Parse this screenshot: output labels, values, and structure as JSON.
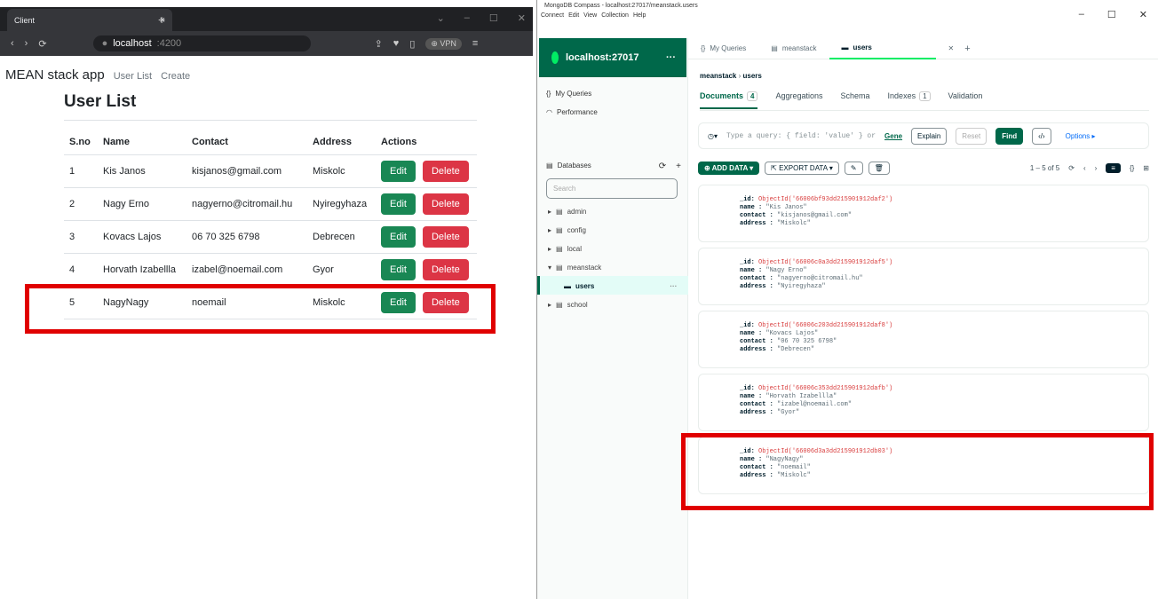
{
  "browser": {
    "tab_title": "Client",
    "tab_close": "×",
    "tab_new": "+",
    "url_host": "localhost",
    "url_port": ":4200",
    "vpn": "⊕ VPN"
  },
  "app": {
    "brand": "MEAN stack app",
    "nav": [
      "User List",
      "Create"
    ],
    "title": "User List",
    "columns": [
      "S.no",
      "Name",
      "Contact",
      "Address",
      "Actions"
    ],
    "edit_label": "Edit",
    "delete_label": "Delete",
    "rows": [
      {
        "sno": "1",
        "name": "Kis Janos",
        "contact": "kisjanos@gmail.com",
        "address": "Miskolc"
      },
      {
        "sno": "2",
        "name": "Nagy Erno",
        "contact": "nagyerno@citromail.hu",
        "address": "Nyiregyhaza"
      },
      {
        "sno": "3",
        "name": "Kovacs Lajos",
        "contact": "06 70 325 6798",
        "address": "Debrecen"
      },
      {
        "sno": "4",
        "name": "Horvath Izabellla",
        "contact": "izabel@noemail.com",
        "address": "Gyor"
      },
      {
        "sno": "5",
        "name": "NagyNagy",
        "contact": "noemail",
        "address": "Miskolc"
      }
    ]
  },
  "compass": {
    "window_title": "MongoDB Compass - localhost:27017/meanstack.users",
    "menu": [
      "Connect",
      "Edit",
      "View",
      "Collection",
      "Help"
    ],
    "host": "localhost:27017",
    "host_more": "···",
    "side_items": [
      "My Queries",
      "Performance"
    ],
    "databases_label": "Databases",
    "search_placeholder": "Search",
    "dbs": [
      "admin",
      "config",
      "local",
      "meanstack",
      "users",
      "school"
    ],
    "tabs": [
      "My Queries",
      "meanstack",
      "users"
    ],
    "breadcrumb_db": "meanstack",
    "breadcrumb_coll": "users",
    "subtabs": [
      {
        "label": "Documents",
        "badge": "4"
      },
      {
        "label": "Aggregations",
        "badge": ""
      },
      {
        "label": "Schema",
        "badge": ""
      },
      {
        "label": "Indexes",
        "badge": "1"
      },
      {
        "label": "Validation",
        "badge": ""
      }
    ],
    "query_placeholder": "Type a query: { field: 'value' } or",
    "generate": "Gene",
    "explain": "Explain",
    "reset": "Reset",
    "find": "Find",
    "options": "Options ▸",
    "add_data": "⊕ ADD DATA ▾",
    "export_data": "⇱ EXPORT DATA ▾",
    "pager": "1 – 5 of 5",
    "docs": [
      {
        "id": "ObjectId('66006bf93dd215901912daf2')",
        "name": "\"Kis Janos\"",
        "contact": "\"kisjanos@gmail.com\"",
        "address": "\"Miskolc\""
      },
      {
        "id": "ObjectId('66006c0a3dd215901912daf5')",
        "name": "\"Nagy Erno\"",
        "contact": "\"nagyerno@citromail.hu\"",
        "address": "\"Nyiregyhaza\""
      },
      {
        "id": "ObjectId('66006c203dd215901912daf8')",
        "name": "\"Kovacs Lajos\"",
        "contact": "\"06 70 325 6798\"",
        "address": "\"Debrecen\""
      },
      {
        "id": "ObjectId('66006c353dd215901912dafb')",
        "name": "\"Horvath Izabellla\"",
        "contact": "\"izabel@noemail.com\"",
        "address": "\"Gyor\""
      },
      {
        "id": "ObjectId('66006d3a3dd215901912db03')",
        "name": "\"NagyNagy\"",
        "contact": "\"noemail\"",
        "address": "\"Miskolc\""
      }
    ]
  },
  "colors": {
    "highlight": "#e00000",
    "mongo_green": "#00684a",
    "edit": "#198754",
    "delete": "#dc3545"
  }
}
